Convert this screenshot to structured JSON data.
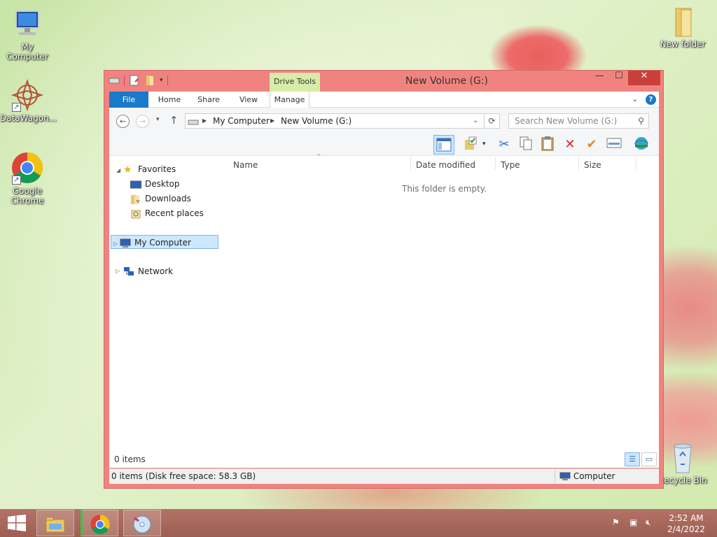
{
  "desktop": {
    "icons": [
      {
        "label": "My Computer"
      },
      {
        "label": "DataWagon..."
      },
      {
        "label": "Google Chrome"
      },
      {
        "label": "New folder"
      },
      {
        "label": "Recycle Bin"
      }
    ]
  },
  "window": {
    "title": "New Volume (G:)",
    "context_tab": "Drive Tools",
    "controls": {
      "minimize": "—",
      "maximize": "☐",
      "close": "✕"
    }
  },
  "ribbon": {
    "tabs": [
      "File",
      "Home",
      "Share",
      "View",
      "Manage"
    ],
    "help": "?"
  },
  "address": {
    "crumbs": [
      "My Computer",
      "New Volume (G:)"
    ],
    "search_placeholder": "Search New Volume (G:)"
  },
  "navpane": {
    "favorites": "Favorites",
    "fav_items": [
      "Desktop",
      "Downloads",
      "Recent places"
    ],
    "my_computer": "My Computer",
    "network": "Network"
  },
  "columns": [
    "Name",
    "Date modified",
    "Type",
    "Size"
  ],
  "content": {
    "empty_message": "This folder is empty.",
    "item_count": "0 items"
  },
  "statusbar": {
    "left": "0 items (Disk free space: 58.3 GB)",
    "right": "Computer"
  },
  "taskbar": {
    "time": "2:52 AM",
    "date": "2/4/2022"
  },
  "colors": {
    "window_frame": "#f0837f",
    "file_tab": "#1979ca",
    "context_tab": "#d8eba8",
    "selection": "#cce8ff"
  }
}
